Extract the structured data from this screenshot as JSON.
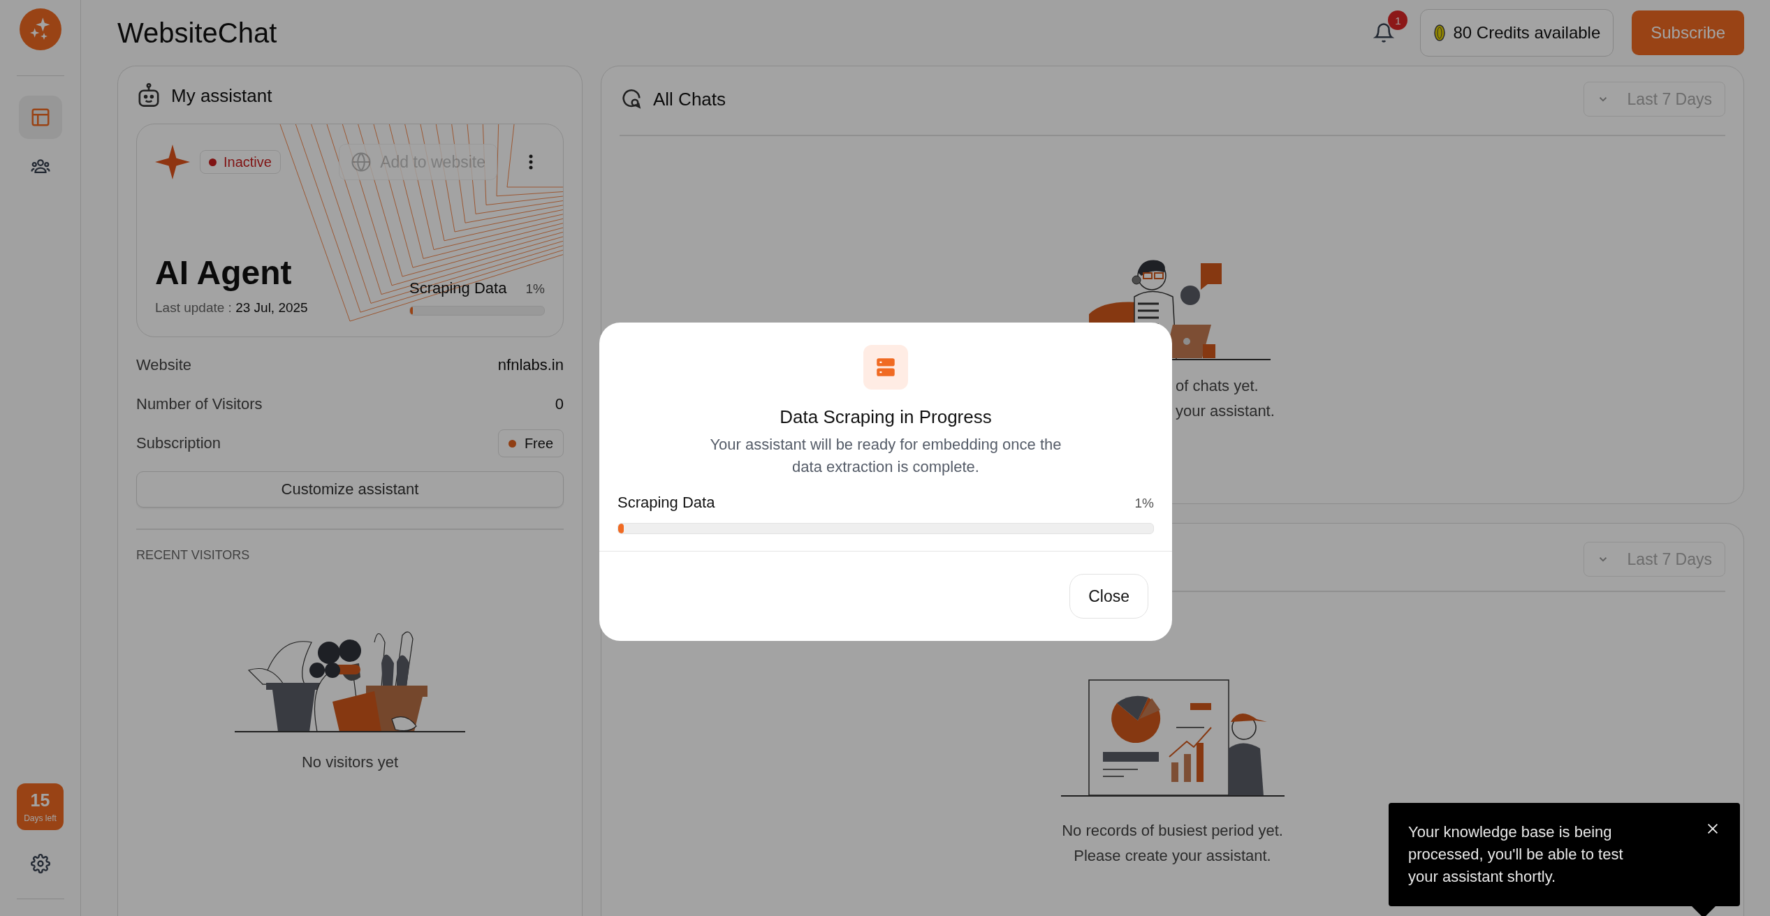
{
  "app": {
    "title": "WebsiteChat"
  },
  "sidebar": {
    "nav": [
      {
        "kind": "dashboard",
        "selected": true
      },
      {
        "kind": "team",
        "selected": false
      }
    ],
    "trial": {
      "days": "15",
      "label": "Days left"
    }
  },
  "header": {
    "notifications": {
      "count": "1"
    },
    "credits": "80 Credits available",
    "subscribe": "Subscribe"
  },
  "assistant": {
    "title": "My assistant",
    "agent": {
      "status": {
        "label": "Inactive"
      },
      "action": {
        "label": "Add to website",
        "disabled": true
      },
      "name": "AI Agent",
      "updated_label": "Last update :",
      "updated": "23 Jul, 2025",
      "progress": {
        "label": "Scraping Data",
        "reading": "1%",
        "level": 0.01
      }
    },
    "details": [
      {
        "kind": "text",
        "label": "Website",
        "value": "nfnlabs.in"
      },
      {
        "kind": "text",
        "label": "Number of Visitors",
        "value": "0"
      },
      {
        "kind": "tag",
        "label": "Subscription",
        "value": "Free"
      }
    ],
    "customize": "Customize assistant",
    "recent_title": "RECENT VISITORS",
    "empty": "No visitors yet"
  },
  "chats": {
    "title": "All Chats",
    "range": "Last 7 Days",
    "empty_lines": [
      "of chats yet.",
      "your assistant."
    ]
  },
  "busiest": {
    "range": "Last 7 Days",
    "empty_lines": [
      "No records of busiest period yet.",
      "Please create your assistant."
    ]
  },
  "modal": {
    "title": "Data Scraping in Progress",
    "text": "Your assistant will be ready for embedding once the data extraction is complete.",
    "progress": {
      "label": "Scraping Data",
      "reading": "1%",
      "level": 0.01
    },
    "close": "Close"
  },
  "toast": {
    "text": "Your knowledge base is being processed, you'll be able to test your assistant shortly."
  }
}
